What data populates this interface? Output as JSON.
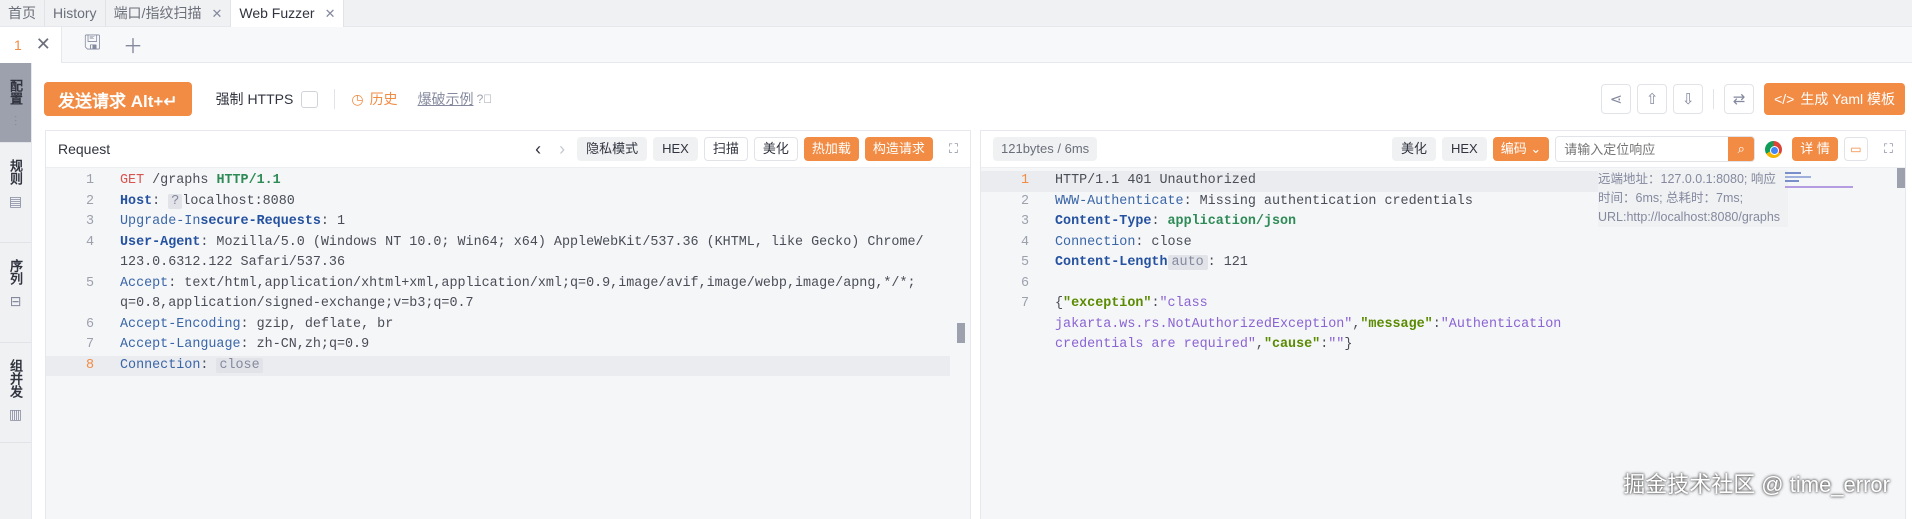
{
  "tabs": [
    {
      "label": "首页"
    },
    {
      "label": "History"
    },
    {
      "label": "端口/指纹扫描",
      "closable": true
    },
    {
      "label": "Web Fuzzer",
      "closable": true,
      "active": true
    }
  ],
  "subtabs": {
    "num": "1"
  },
  "sidebar": [
    {
      "label": "配置",
      "icon": "sliders-icon"
    },
    {
      "label": "规则",
      "icon": "clipboard-icon"
    },
    {
      "label": "序列",
      "icon": "stack-icon"
    },
    {
      "label": "组并发",
      "icon": "columns-icon"
    }
  ],
  "toolbar": {
    "send": "发送请求 Alt+↵",
    "https": "强制 HTTPS",
    "history": "历史",
    "demo": "爆破示例",
    "yaml": "生成 Yaml 模板"
  },
  "request": {
    "title": "Request",
    "buttons": {
      "privacy": "隐私模式",
      "hex": "HEX",
      "scan": "扫描",
      "beautify": "美化",
      "hotload": "热加载",
      "construct": "构造请求"
    },
    "lines": [
      {
        "n": "1",
        "parts": [
          [
            "m",
            "GET"
          ],
          [
            "t",
            " /graphs "
          ],
          [
            "v",
            "HTTP/1.1"
          ]
        ]
      },
      {
        "n": "2",
        "parts": [
          [
            "kb",
            "Host"
          ],
          [
            "t",
            ": "
          ],
          [
            "pill",
            "?"
          ],
          [
            "t",
            "localhost:8080"
          ]
        ]
      },
      {
        "n": "3",
        "parts": [
          [
            "k",
            "Upgrade-In"
          ],
          [
            "kb",
            "secure-Requests"
          ],
          [
            "t",
            ": 1"
          ]
        ]
      },
      {
        "n": "4",
        "parts": [
          [
            "kb",
            "User-Agent"
          ],
          [
            "t",
            ": Mozilla/5.0 (Windows NT 10.0; Win64; x64) AppleWebKit/537.36 (KHTML, like Gecko) Chrome/ 123.0.6312.122 Safari/537.36"
          ]
        ]
      },
      {
        "n": "5",
        "parts": [
          [
            "k",
            "Accept"
          ],
          [
            "t",
            ": text/html,application/xhtml+xml,application/xml;q=0.9,image/avif,image/webp,image/apng,*/*; q=0.8,application/signed-exchange;v=b3;q=0.7"
          ]
        ]
      },
      {
        "n": "6",
        "parts": [
          [
            "k",
            "Accept-Encoding"
          ],
          [
            "t",
            ": gzip, deflate, br"
          ]
        ]
      },
      {
        "n": "7",
        "parts": [
          [
            "k",
            "Accept-Language"
          ],
          [
            "t",
            ": zh-CN,zh;q=0.9"
          ]
        ]
      },
      {
        "n": "8",
        "parts": [
          [
            "k",
            "Connection"
          ],
          [
            "t",
            ": "
          ],
          [
            "pill",
            "close"
          ]
        ],
        "current": true
      }
    ]
  },
  "response": {
    "stat": "121bytes / 6ms",
    "buttons": {
      "beautify": "美化",
      "hex": "HEX",
      "encode": "编码",
      "detail": "详 情"
    },
    "search_placeholder": "请输入定位响应",
    "tooltip": "远端地址：127.0.0.1:8080; 响应时间：6ms; 总耗时：7ms; URL:http://localhost:8080/graphs",
    "lines": [
      {
        "n": "1",
        "parts": [
          [
            "t",
            "HTTP/1.1 401 Unauthorized"
          ]
        ],
        "current": true
      },
      {
        "n": "2",
        "parts": [
          [
            "k",
            "WWW-Authenticate"
          ],
          [
            "t",
            ": Missing authentication credentials"
          ]
        ]
      },
      {
        "n": "3",
        "parts": [
          [
            "kb",
            "Content-Type"
          ],
          [
            "t",
            ": "
          ],
          [
            "v",
            "application/json"
          ]
        ]
      },
      {
        "n": "4",
        "parts": [
          [
            "k",
            "Connection"
          ],
          [
            "t",
            ": close"
          ]
        ]
      },
      {
        "n": "5",
        "parts": [
          [
            "kb",
            "Content-Length"
          ],
          [
            "ctag",
            "auto"
          ],
          [
            "t",
            ": 121"
          ]
        ]
      },
      {
        "n": "6",
        "parts": [
          [
            "t",
            ""
          ]
        ]
      },
      {
        "n": "7",
        "parts": [
          [
            "t",
            "{"
          ],
          [
            "jk",
            "\"exception\""
          ],
          [
            "t",
            ":"
          ],
          [
            "js",
            "\"class jakarta.ws.rs.NotAuthorizedException\""
          ],
          [
            "t",
            ","
          ],
          [
            "jk",
            "\"message\""
          ],
          [
            "t",
            ":"
          ],
          [
            "js",
            "\"Authentication credentials are required\""
          ],
          [
            "t",
            ","
          ],
          [
            "jk",
            "\"cause\""
          ],
          [
            "t",
            ":"
          ],
          [
            "js",
            "\"\""
          ],
          [
            "t",
            "}"
          ]
        ]
      }
    ]
  },
  "watermark": "掘金技术社区 @ time_error",
  "colors": {
    "accent": "#f28b44"
  }
}
